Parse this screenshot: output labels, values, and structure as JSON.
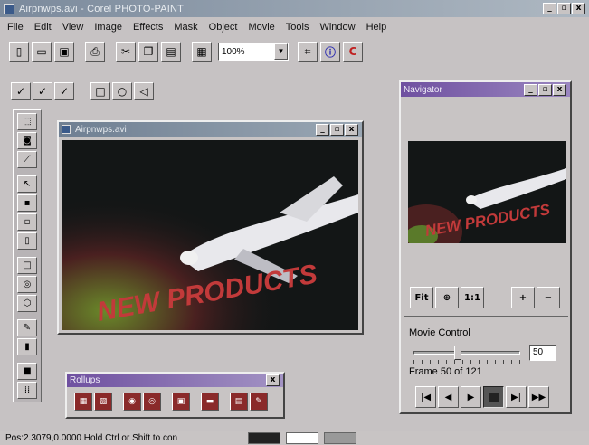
{
  "app": {
    "title": "Airpnwps.avi - Corel PHOTO-PAINT",
    "window_buttons": {
      "minimize": "_",
      "maximize": "▫",
      "close": "x"
    }
  },
  "menu": [
    "File",
    "Edit",
    "View",
    "Image",
    "Effects",
    "Mask",
    "Object",
    "Movie",
    "Tools",
    "Window",
    "Help"
  ],
  "toolbar": {
    "zoom_value": "100%",
    "icons": [
      "new-icon",
      "open-icon",
      "save-icon",
      "print-icon",
      "cut-icon",
      "copy-icon",
      "paste-icon",
      "zoom-mode-icon",
      "fit-icon",
      "info-icon",
      "corel-icon"
    ]
  },
  "image_window": {
    "title": "Airpnwps.avi",
    "art_text": "NEW PRODUCTS"
  },
  "navigator": {
    "title": "Navigator",
    "art_text": "NEW PRODUCTS",
    "tools": {
      "fit": "Fit",
      "zoom": "⊕",
      "one_to_one": "1:1",
      "zoom_in": "+",
      "zoom_out": "−"
    },
    "movie_control_label": "Movie Control",
    "frame_value": "50",
    "frame_info": "Frame 50 of 121",
    "frame_current": 50,
    "frame_total": 121
  },
  "rollups": {
    "title": "Rollups"
  },
  "statusbar": {
    "text": "Pos:2.3079,0.0000   Hold Ctrl or Shift to con"
  },
  "colors": {
    "title_gradient_start": "#7b8a9c",
    "rollup_title": "#6f50a0",
    "art_red": "#c23a3a"
  }
}
